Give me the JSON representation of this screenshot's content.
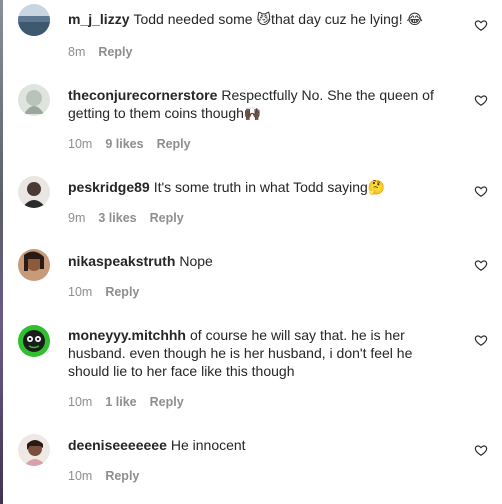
{
  "comments": [
    {
      "username": "m_j_lizzy",
      "text": "Todd needed some 😼that day cuz he lying! 😂",
      "time": "8m",
      "likes": "",
      "reply": "Reply",
      "avatar_icon": "blue-water-avatar",
      "avatar_color": "#5d7790"
    },
    {
      "username": "theconjurecornerstore",
      "text": "Respectfully No. She the queen of getting to them coins though🙌🏿",
      "time": "10m",
      "likes": "9 likes",
      "reply": "Reply",
      "avatar_icon": "plant-avatar",
      "avatar_color": "#b9c2bb"
    },
    {
      "username": "peskridge89",
      "text": "It's some truth in what Todd saying🤔",
      "time": "9m",
      "likes": "3 likes",
      "reply": "Reply",
      "avatar_icon": "person-avatar",
      "avatar_color": "#4b3a33"
    },
    {
      "username": "nikaspeakstruth",
      "text": "Nope",
      "time": "10m",
      "likes": "",
      "reply": "Reply",
      "avatar_icon": "person-avatar",
      "avatar_color": "#8c5a3c"
    },
    {
      "username": "moneyyy.mitchhh",
      "text": "of course he will say that. he is her husband. even though he is her husband, i don't feel he should lie to her face like this though",
      "time": "10m",
      "likes": "1 like",
      "reply": "Reply",
      "avatar_icon": "green-character-avatar",
      "avatar_color": "#2fbf2f"
    },
    {
      "username": "deeniseeeeeee",
      "text": "He innocent",
      "time": "10m",
      "likes": "",
      "reply": "Reply",
      "avatar_icon": "person-avatar",
      "avatar_color": "#7a4f3d"
    }
  ]
}
